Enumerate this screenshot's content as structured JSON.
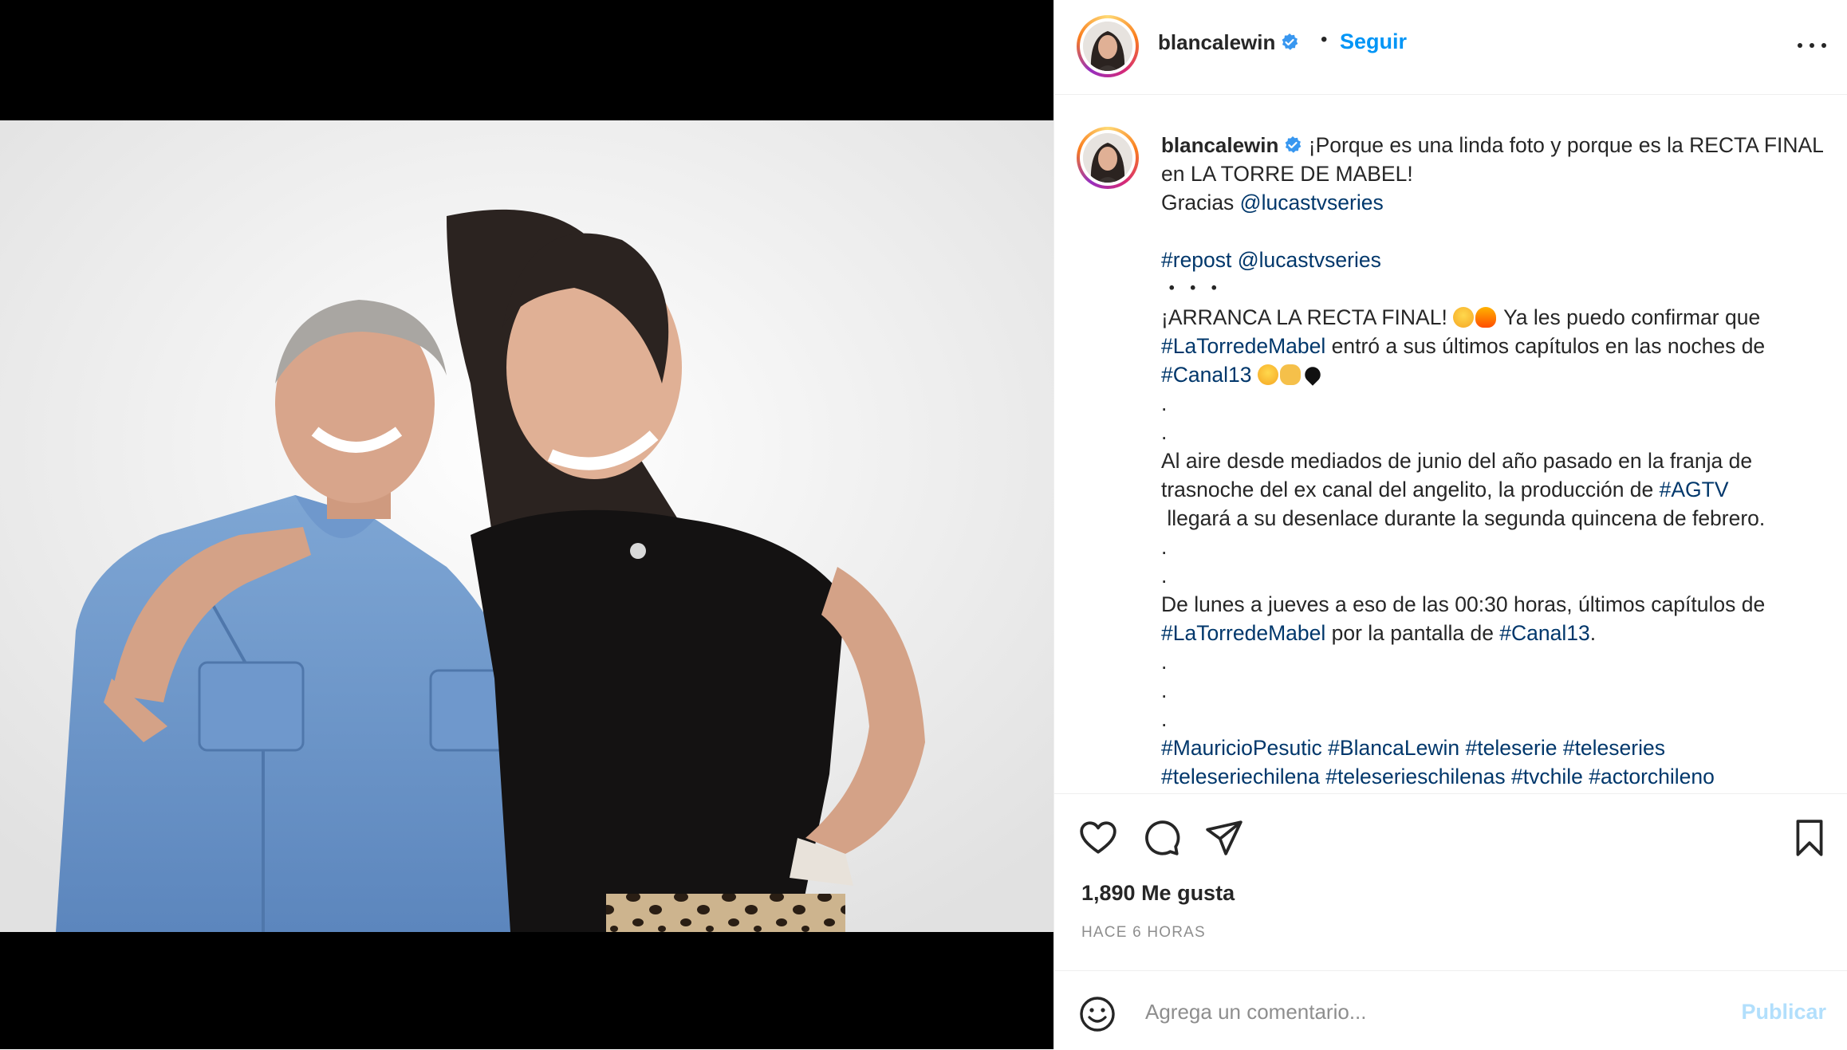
{
  "post": {
    "username": "blancalewin",
    "follow_label": "Seguir",
    "separator": "•",
    "likes_text": "1,890 Me gusta",
    "time_text": "HACE 6 HORAS"
  },
  "caption": {
    "line1": "¡Porque es una linda foto y porque es la RECTA FINAL en LA TORRE DE MABEL!",
    "gracias": "Gracias ",
    "mention": "@lucastvseries",
    "repost_tag": "#repost",
    "repost_mention": "@lucastvseries",
    "dots": "・・・",
    "arranca": "¡ARRANCA LA RECTA FINAL! ",
    "confirm": " Ya les puedo confirmar que ",
    "tag_mabel": "#LaTorredeMabel",
    "entro": " entró a sus últimos capítulos en las noches de ",
    "tag_canal13": "#Canal13",
    "dot": ".",
    "aire": "Al aire desde mediados de junio del año pasado en la franja de trasnoche del ex canal del angelito, la producción de ",
    "tag_agtv": "#AGTV",
    "llegara": " llegará a su desenlace durante la segunda quincena de febrero.",
    "lunes": "De lunes a jueves a eso de las 00:30 horas, últimos capítulos de ",
    "pantalla": " por la pantalla de ",
    "period": ".",
    "hashtags": [
      "#MauricioPesutic",
      "#BlancaLewin",
      "#teleserie",
      "#teleseries",
      "#teleseriechilena",
      "#teleserieschilenas",
      "#tvchile",
      "#actorchileno"
    ]
  },
  "comment": {
    "placeholder": "Agrega un comentario...",
    "publish_label": "Publicar"
  },
  "colors": {
    "link": "#00376b",
    "follow": "#0095f6",
    "publish_disabled": "#b2dffc",
    "verified": "#3897f0"
  },
  "icons": [
    "heart-icon",
    "comment-icon",
    "share-icon",
    "bookmark-icon",
    "emoji-icon",
    "more-icon",
    "verified-badge-icon"
  ]
}
